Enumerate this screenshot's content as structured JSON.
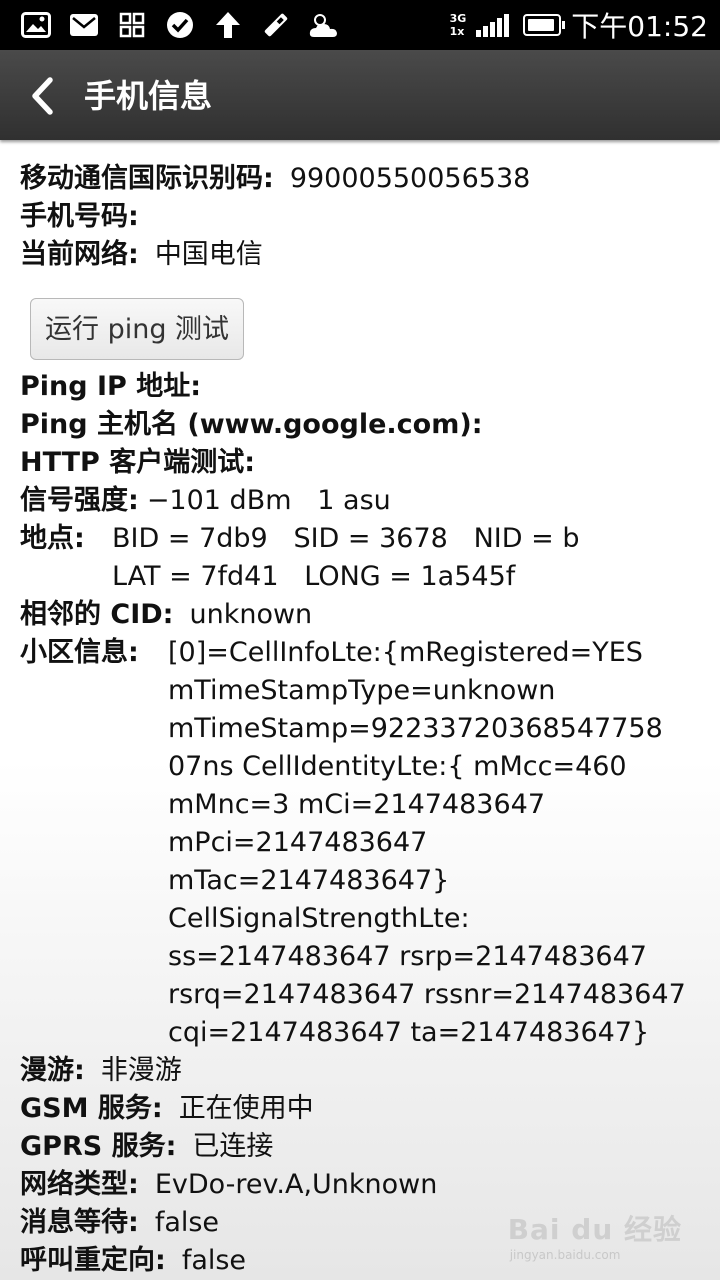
{
  "status_bar": {
    "network_top": "3G",
    "network_bottom": "1x",
    "time": "下午01:52",
    "icons": [
      "image-icon",
      "mail-icon",
      "apps-icon",
      "check-circle-icon",
      "upload-icon",
      "tools-icon",
      "weather-icon"
    ]
  },
  "action_bar": {
    "title": "手机信息"
  },
  "info": {
    "imei_label": "移动通信国际识别码:",
    "imei_value": "99000550056538",
    "phone_label": "手机号码:",
    "network_label": "当前网络:",
    "network_value": "中国电信",
    "ping_button": "运行 ping 测试",
    "ping_ip_label": "Ping IP 地址:",
    "ping_host_label": "Ping 主机名 (www.google.com):",
    "http_label": "HTTP 客户端测试:",
    "signal_label": "信号强度:",
    "signal_value": "−101 dBm   1 asu",
    "location_label": "地点:",
    "location_line1": "BID = 7db9   SID = 3678   NID = b",
    "location_line2": "LAT = 7fd41   LONG = 1a545f",
    "neighbor_label": "相邻的 CID:",
    "neighbor_value": "unknown",
    "cell_label": "小区信息:",
    "cell_lines": [
      "[0]=CellInfoLte:{mRegistered=YES",
      "mTimeStampType=unknown",
      "mTimeStamp=92233720368547758",
      "07ns CellIdentityLte:{ mMcc=460",
      "mMnc=3 mCi=2147483647",
      "mPci=2147483647",
      "mTac=2147483647}",
      "CellSignalStrengthLte:",
      "ss=2147483647 rsrp=2147483647",
      "rsrq=2147483647 rssnr=2147483647",
      "cqi=2147483647 ta=2147483647}"
    ],
    "roaming_label": "漫游:",
    "roaming_value": "非漫游",
    "gsm_label": "GSM 服务:",
    "gsm_value": "正在使用中",
    "gprs_label": "GPRS 服务:",
    "gprs_value": "已连接",
    "nettype_label": "网络类型:",
    "nettype_value": "EvDo-rev.A,Unknown",
    "msgwait_label": "消息等待:",
    "msgwait_value": "false",
    "callfwd_label": "呼叫重定向:",
    "callfwd_value": "false"
  },
  "watermark": {
    "main": "Bai du 经验",
    "sub": "jingyan.baidu.com"
  }
}
